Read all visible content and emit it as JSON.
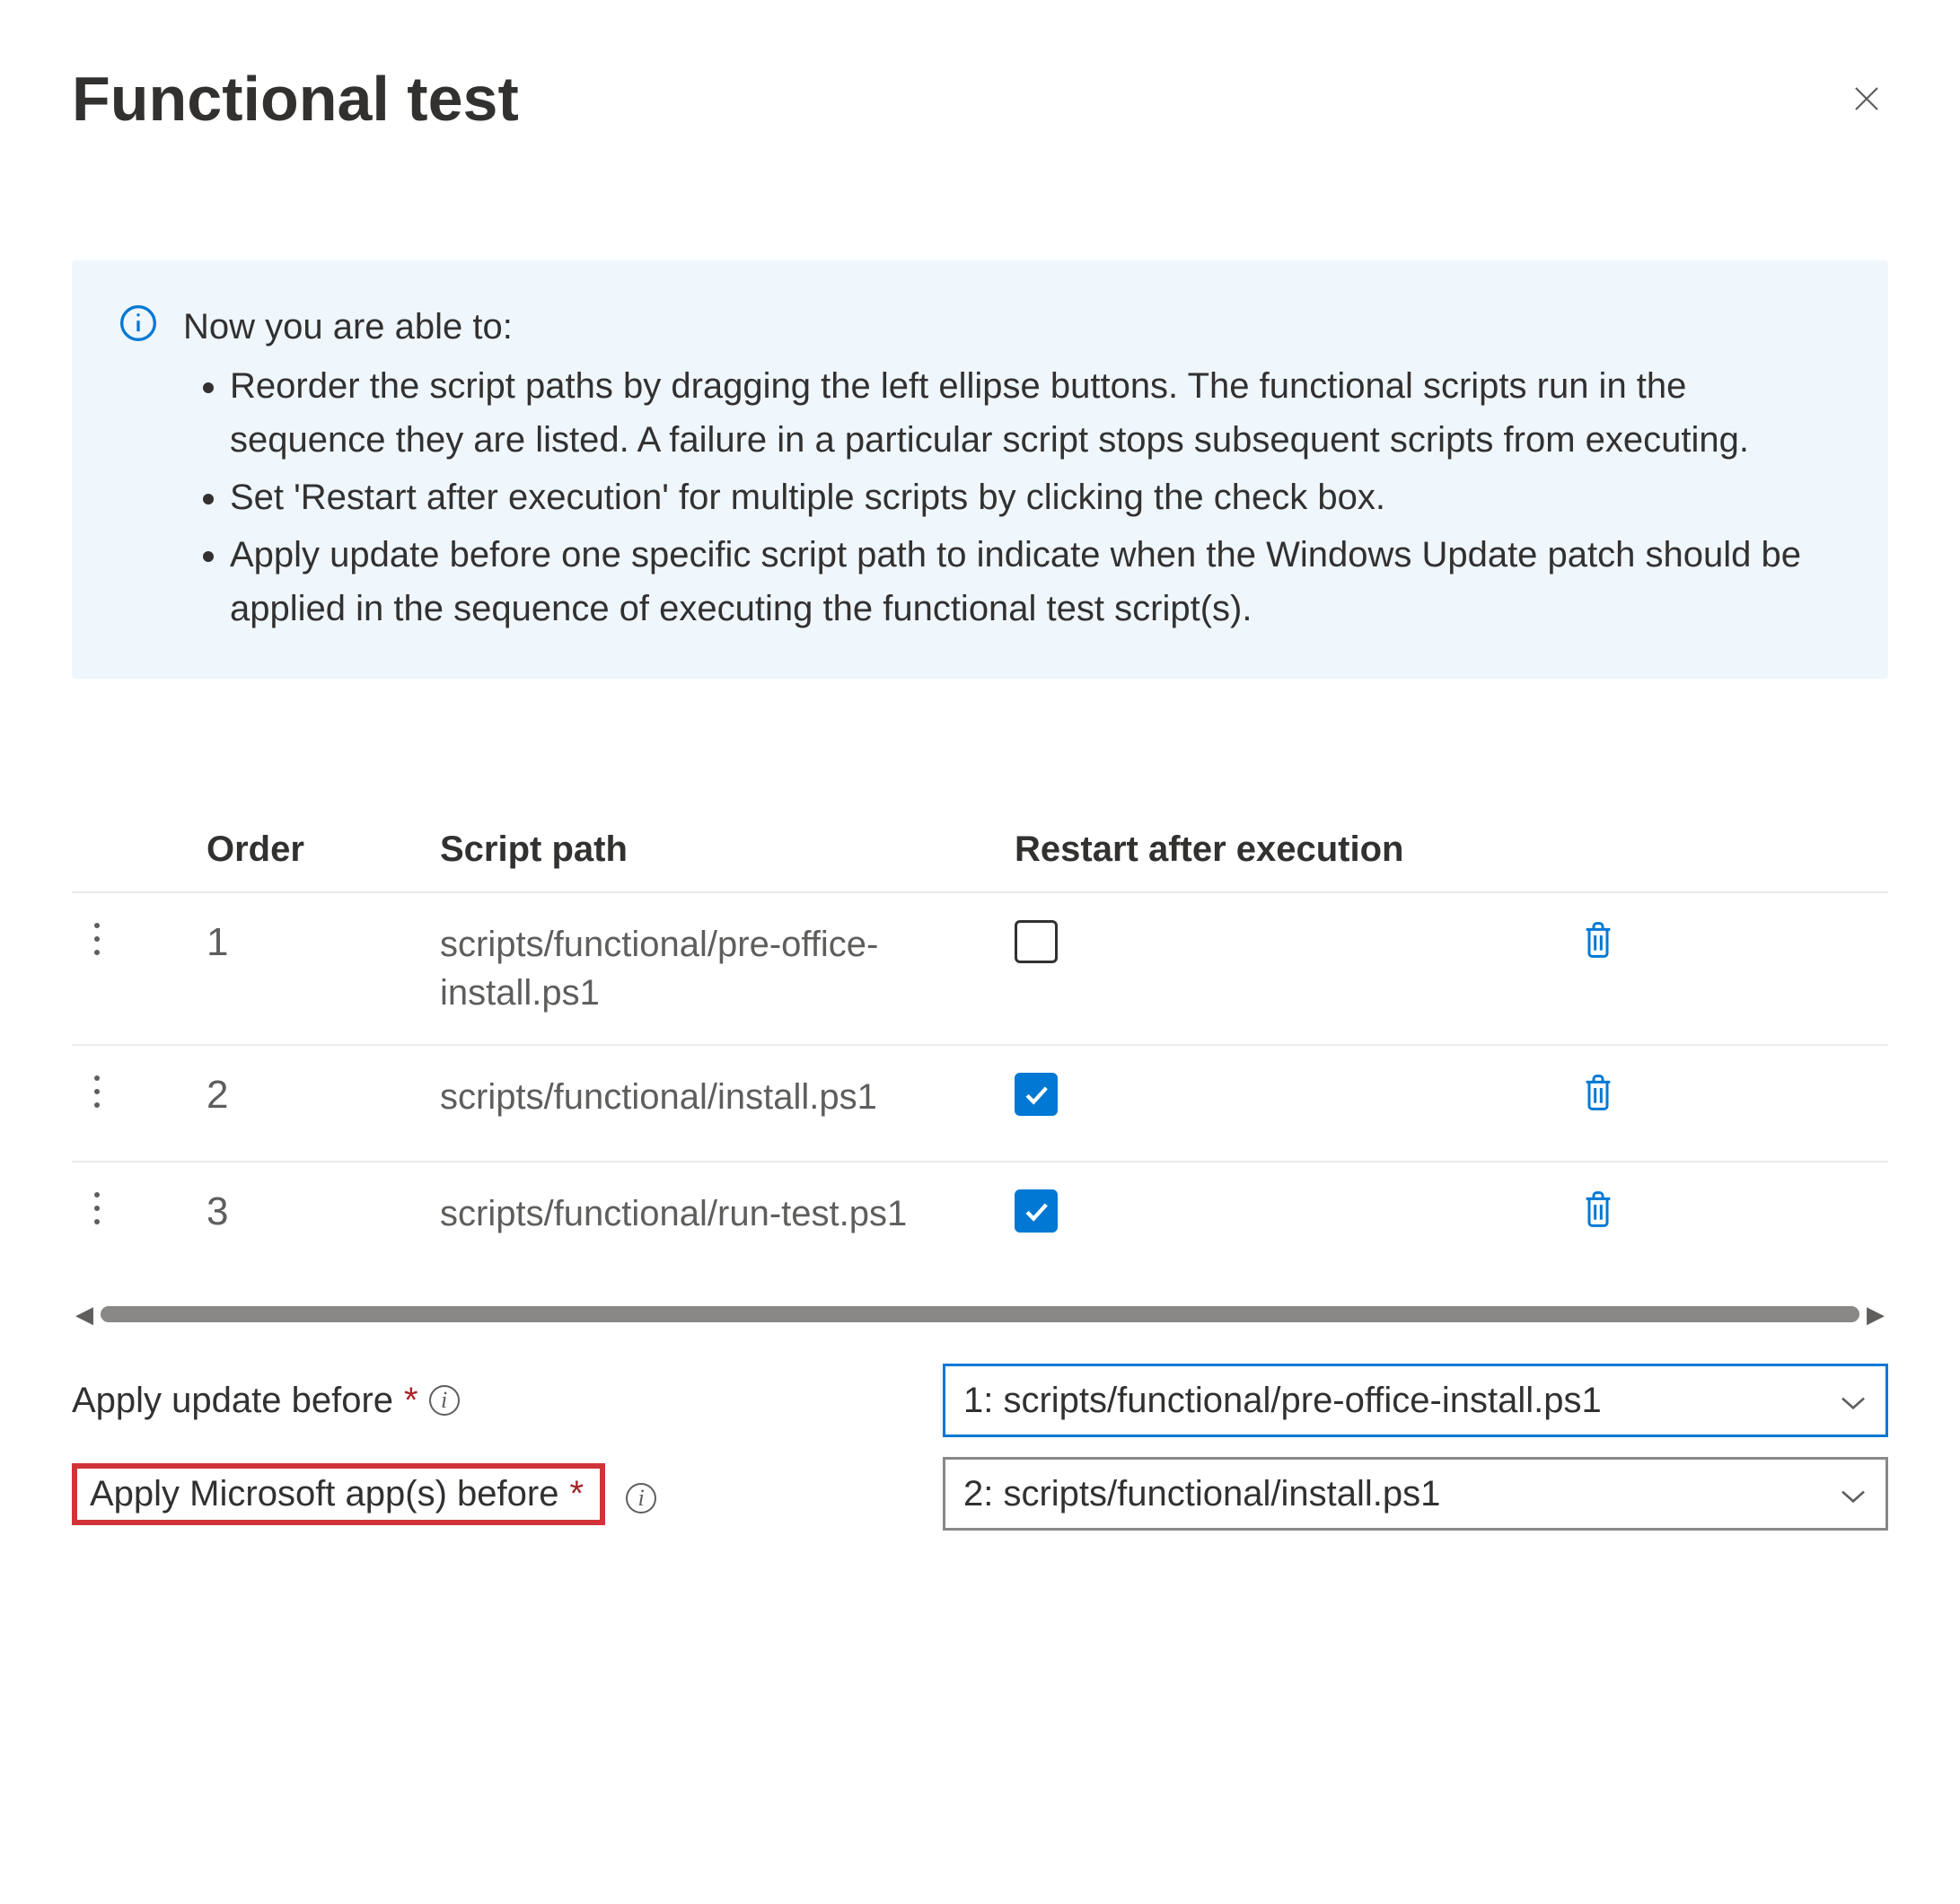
{
  "title": "Functional test",
  "info": {
    "intro": "Now you are able to:",
    "bullets": [
      "Reorder the script paths by dragging the left ellipse buttons. The functional scripts run in the sequence they are listed. A failure in a particular script stops subsequent scripts from executing.",
      "Set 'Restart after execution' for multiple scripts by clicking the check box.",
      "Apply update before one specific script path to indicate when the Windows Update patch should be applied in the sequence of executing the functional test script(s)."
    ]
  },
  "columns": {
    "order": "Order",
    "path": "Script path",
    "restart": "Restart after execution"
  },
  "rows": [
    {
      "order": "1",
      "path": "scripts/functional/pre-office-install.ps1",
      "restart": false
    },
    {
      "order": "2",
      "path": "scripts/functional/install.ps1",
      "restart": true
    },
    {
      "order": "3",
      "path": "scripts/functional/run-test.ps1",
      "restart": true
    }
  ],
  "dropdowns": {
    "apply_update": {
      "label": "Apply update before",
      "value": "1: scripts/functional/pre-office-install.ps1"
    },
    "apply_ms_app": {
      "label": "Apply Microsoft app(s) before",
      "value": "2: scripts/functional/install.ps1"
    }
  }
}
